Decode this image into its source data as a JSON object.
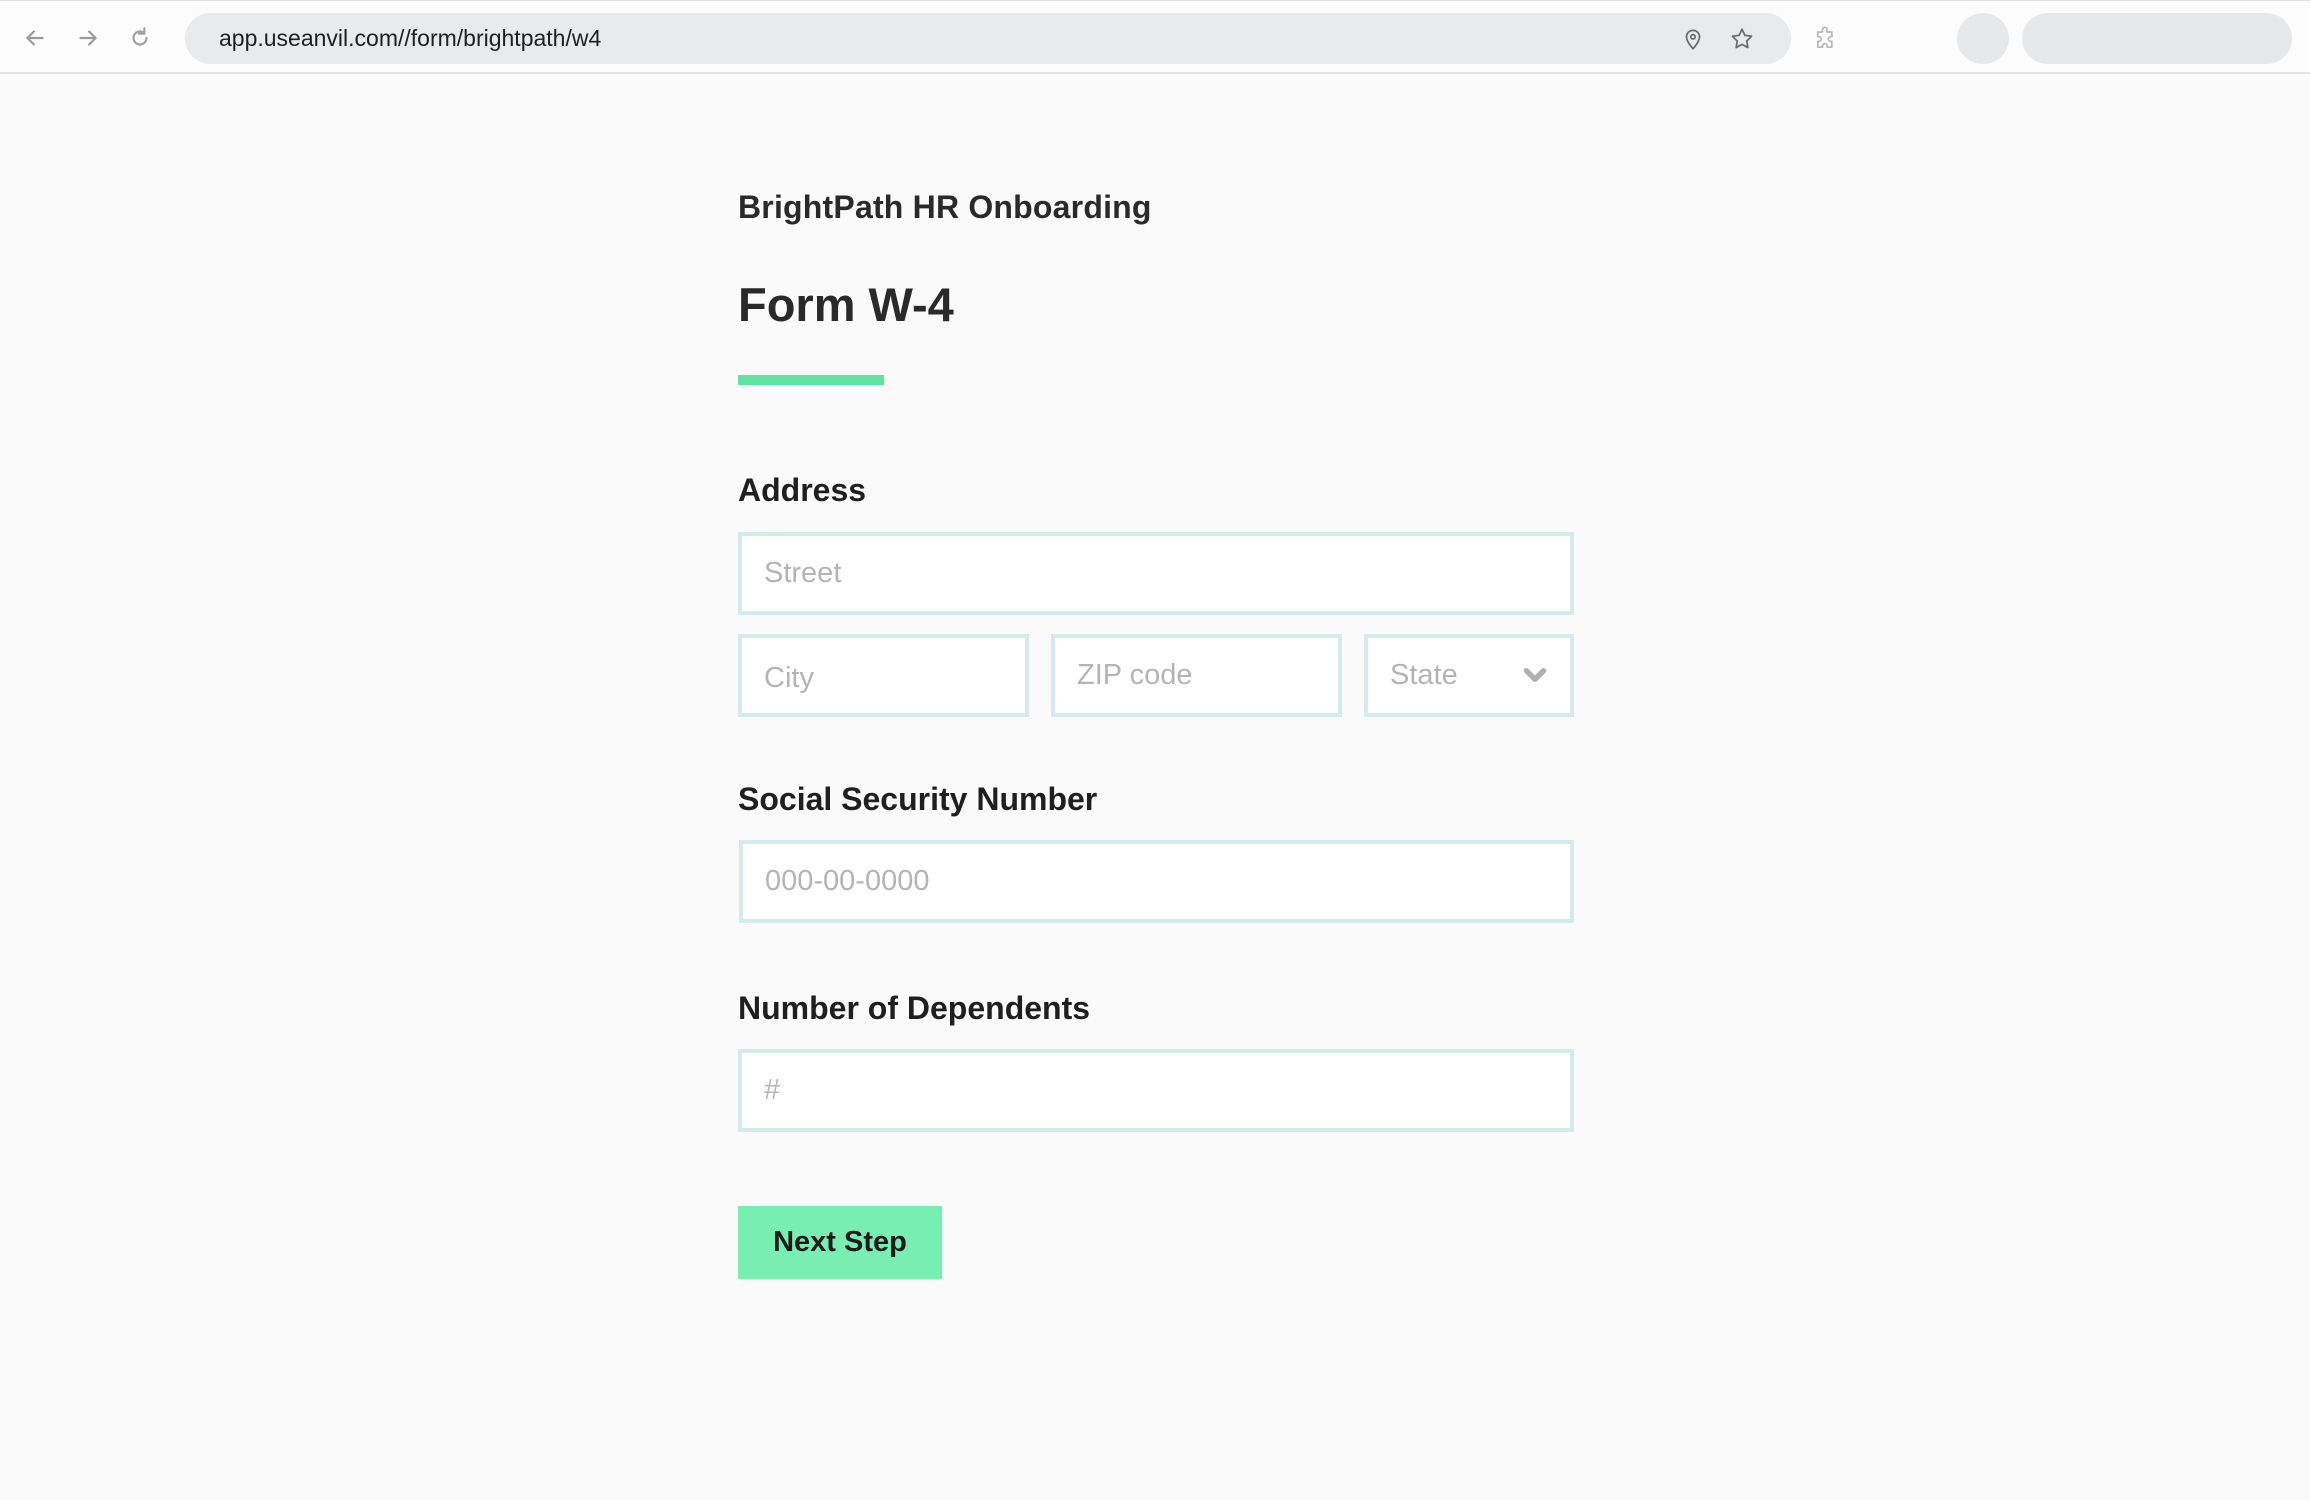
{
  "browser": {
    "url": "app.useanvil.com//form/brightpath/w4",
    "icons": {
      "back": "arrow-left-icon",
      "forward": "arrow-right-icon",
      "reload": "reload-icon",
      "location": "location-pin-icon",
      "bookmark": "star-icon",
      "extensions": "puzzle-icon"
    }
  },
  "header": {
    "org_title": "BrightPath HR Onboarding",
    "form_title": "Form W-4",
    "accent_color": "#5ee3a0"
  },
  "form": {
    "address": {
      "label": "Address",
      "street_placeholder": "Street",
      "city_placeholder": "City",
      "zip_placeholder": "ZIP code",
      "state_placeholder": "State"
    },
    "ssn": {
      "label": "Social Security Number",
      "placeholder": "000-00-0000"
    },
    "dependents": {
      "label": "Number of Dependents",
      "placeholder": "#"
    },
    "next_button": {
      "label": "Next Step",
      "color": "#79eeb3"
    },
    "field_border_color": "#d5ebeb"
  }
}
